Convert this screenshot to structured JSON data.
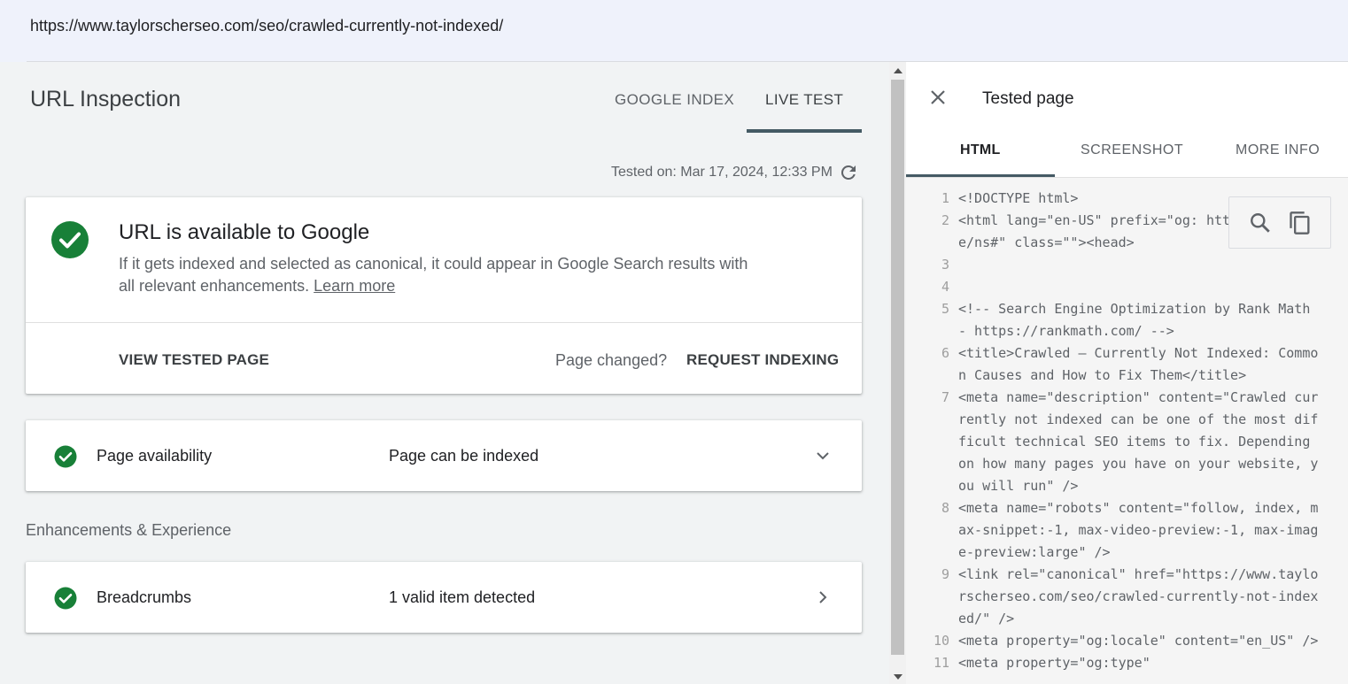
{
  "url_bar": {
    "url": "https://www.taylorscherseo.com/seo/crawled-currently-not-indexed/"
  },
  "header": {
    "title": "URL Inspection",
    "tabs": [
      {
        "label": "GOOGLE INDEX",
        "active": false
      },
      {
        "label": "LIVE TEST",
        "active": true
      }
    ],
    "tested_on": "Tested on: Mar 17, 2024, 12:33 PM"
  },
  "status_card": {
    "title": "URL is available to Google",
    "description": "If it gets indexed and selected as canonical, it could appear in Google Search results with all relevant enhancements.",
    "learn_more": "Learn more",
    "view_tested_page": "VIEW TESTED PAGE",
    "page_changed": "Page changed?",
    "request_indexing": "REQUEST INDEXING"
  },
  "availability": {
    "label": "Page availability",
    "value": "Page can be indexed"
  },
  "enhancements": {
    "heading": "Enhancements & Experience",
    "items": [
      {
        "label": "Breadcrumbs",
        "value": "1 valid item detected"
      }
    ]
  },
  "tested_panel": {
    "title": "Tested page",
    "tabs": [
      {
        "label": "HTML",
        "active": true
      },
      {
        "label": "SCREENSHOT",
        "active": false
      },
      {
        "label": "MORE INFO",
        "active": false
      }
    ],
    "code": [
      {
        "num": "1",
        "text": "<!DOCTYPE html>"
      },
      {
        "num": "2",
        "text": "<html lang=\"en-US\" prefix=\"og: https://ogp.me/ns#\" class=\"\"><head>"
      },
      {
        "num": "3",
        "text": ""
      },
      {
        "num": "4",
        "text": ""
      },
      {
        "num": "5",
        "text": "<!-- Search Engine Optimization by Rank Math - https://rankmath.com/ -->"
      },
      {
        "num": "6",
        "text": "<title>Crawled – Currently Not Indexed: Common Causes and How to Fix Them</title>"
      },
      {
        "num": "7",
        "text": "<meta name=\"description\" content=\"Crawled currently not indexed can be one of the most difficult technical SEO items to fix. Depending on how many pages you have on your website, you will run\" />"
      },
      {
        "num": "8",
        "text": "<meta name=\"robots\" content=\"follow, index, max-snippet:-1, max-video-preview:-1, max-image-preview:large\" />"
      },
      {
        "num": "9",
        "text": "<link rel=\"canonical\" href=\"https://www.taylorscherseo.com/seo/crawled-currently-not-indexed/\" />"
      },
      {
        "num": "10",
        "text": "<meta property=\"og:locale\" content=\"en_US\" />"
      },
      {
        "num": "11",
        "text": "<meta property=\"og:type\""
      }
    ]
  },
  "colors": {
    "success_green": "#188038",
    "accent_dark": "#455a64"
  },
  "icons": [
    "check-circle-icon",
    "refresh-icon",
    "chevron-down-icon",
    "chevron-right-icon",
    "close-icon",
    "search-icon",
    "copy-icon"
  ]
}
